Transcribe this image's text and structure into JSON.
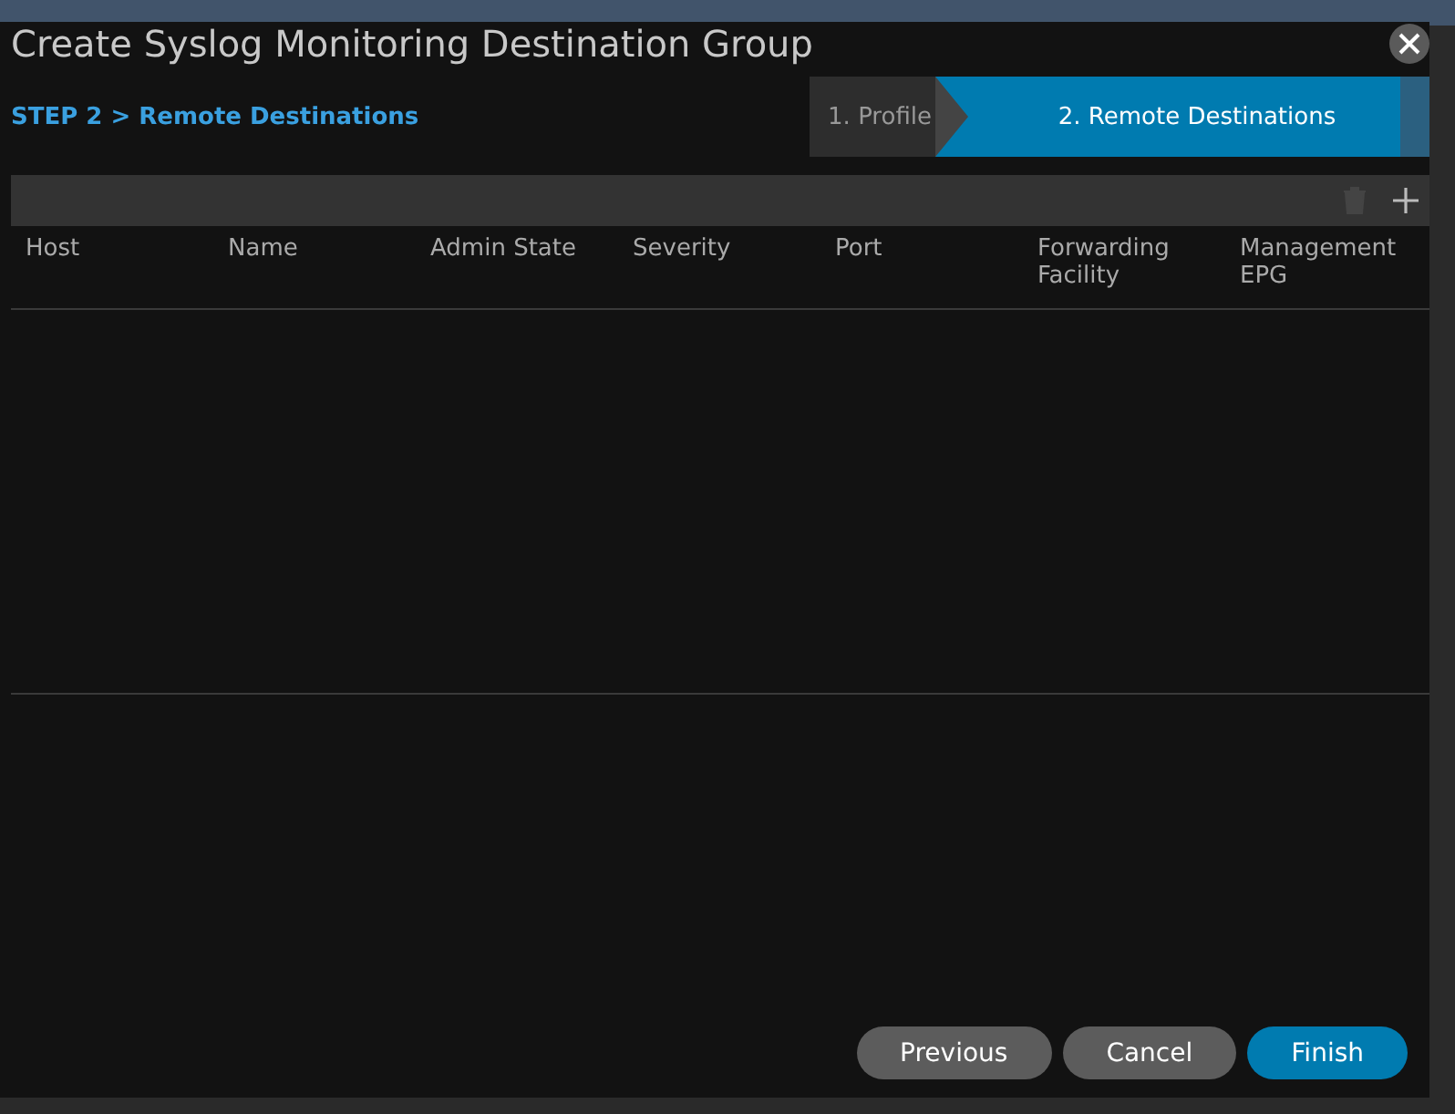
{
  "dialog": {
    "title": "Create Syslog Monitoring Destination Group",
    "breadcrumb": "STEP 2 > Remote Destinations"
  },
  "steps": [
    {
      "label": "1. Profile",
      "selected": false
    },
    {
      "label": "2. Remote Destinations",
      "selected": true
    }
  ],
  "table": {
    "columns": [
      "Host",
      "Name",
      "Admin State",
      "Severity",
      "Port",
      "Forwarding Facility",
      "Management EPG"
    ]
  },
  "buttons": [
    {
      "label": "Previous",
      "kind": "secondary"
    },
    {
      "label": "Cancel",
      "kind": "secondary"
    },
    {
      "label": "Finish",
      "kind": "primary"
    }
  ]
}
